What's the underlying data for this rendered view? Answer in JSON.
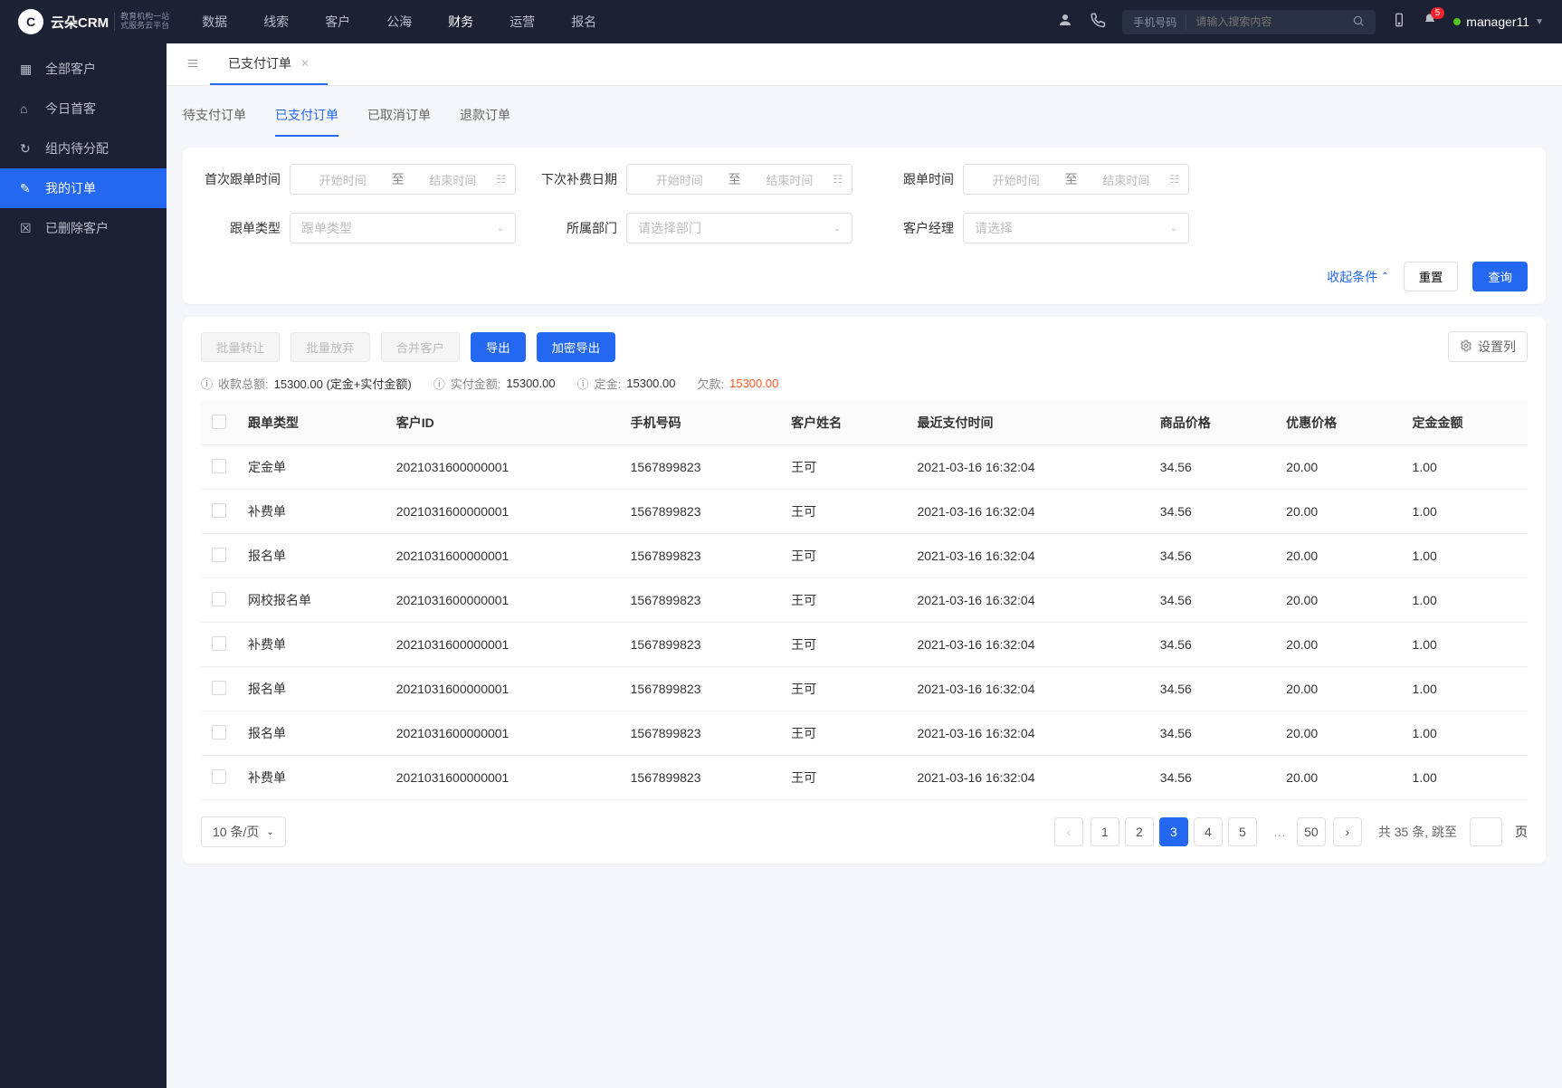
{
  "logo": {
    "brand": "云朵CRM",
    "sub1": "教育机构一站",
    "sub2": "式服务云平台"
  },
  "topnav": {
    "items": [
      "数据",
      "线索",
      "客户",
      "公海",
      "财务",
      "运营",
      "报名"
    ],
    "active": 4
  },
  "search": {
    "type_label": "手机号码",
    "placeholder": "请输入搜索内容"
  },
  "notif_count": "5",
  "user_name": "manager11",
  "sidebar": {
    "items": [
      {
        "label": "全部客户"
      },
      {
        "label": "今日首客"
      },
      {
        "label": "组内待分配"
      },
      {
        "label": "我的订单"
      },
      {
        "label": "已删除客户"
      }
    ],
    "active": 3
  },
  "page_tab": {
    "label": "已支付订单"
  },
  "sub_tabs": {
    "items": [
      "待支付订单",
      "已支付订单",
      "已取消订单",
      "退款订单"
    ],
    "active": 1
  },
  "filters": {
    "first_follow": {
      "label": "首次跟单时间",
      "start": "开始时间",
      "end": "结束时间",
      "split": "至"
    },
    "next_fee": {
      "label": "下次补费日期",
      "start": "开始时间",
      "end": "结束时间",
      "split": "至"
    },
    "follow_time": {
      "label": "跟单时间",
      "start": "开始时间",
      "end": "结束时间",
      "split": "至"
    },
    "follow_type": {
      "label": "跟单类型",
      "placeholder": "跟单类型"
    },
    "dept": {
      "label": "所属部门",
      "placeholder": "请选择部门"
    },
    "manager": {
      "label": "客户经理",
      "placeholder": "请选择"
    },
    "collapse": "收起条件",
    "reset": "重置",
    "query": "查询"
  },
  "toolbar": {
    "batch_transfer": "批量转让",
    "batch_abandon": "批量放弃",
    "merge": "合并客户",
    "export": "导出",
    "encrypt_export": "加密导出",
    "settings": "设置列"
  },
  "stats": {
    "receive_label": "收款总额:",
    "receive_val": "15300.00 (定金+实付金额)",
    "paid_label": "实付金额:",
    "paid_val": "15300.00",
    "deposit_label": "定金:",
    "deposit_val": "15300.00",
    "debt_label": "欠款:",
    "debt_val": "15300.00"
  },
  "columns": [
    "跟单类型",
    "客户ID",
    "手机号码",
    "客户姓名",
    "最近支付时间",
    "商品价格",
    "优惠价格",
    "定金金额"
  ],
  "rows": [
    [
      "定金单",
      "2021031600000001",
      "1567899823",
      "王可",
      "2021-03-16 16:32:04",
      "34.56",
      "20.00",
      "1.00"
    ],
    [
      "补费单",
      "2021031600000001",
      "1567899823",
      "王可",
      "2021-03-16 16:32:04",
      "34.56",
      "20.00",
      "1.00"
    ],
    [
      "报名单",
      "2021031600000001",
      "1567899823",
      "王可",
      "2021-03-16 16:32:04",
      "34.56",
      "20.00",
      "1.00"
    ],
    [
      "网校报名单",
      "2021031600000001",
      "1567899823",
      "王可",
      "2021-03-16 16:32:04",
      "34.56",
      "20.00",
      "1.00"
    ],
    [
      "补费单",
      "2021031600000001",
      "1567899823",
      "王可",
      "2021-03-16 16:32:04",
      "34.56",
      "20.00",
      "1.00"
    ],
    [
      "报名单",
      "2021031600000001",
      "1567899823",
      "王可",
      "2021-03-16 16:32:04",
      "34.56",
      "20.00",
      "1.00"
    ],
    [
      "报名单",
      "2021031600000001",
      "1567899823",
      "王可",
      "2021-03-16 16:32:04",
      "34.56",
      "20.00",
      "1.00"
    ],
    [
      "补费单",
      "2021031600000001",
      "1567899823",
      "王可",
      "2021-03-16 16:32:04",
      "34.56",
      "20.00",
      "1.00"
    ]
  ],
  "pagination": {
    "per_page_label": "10 条/页",
    "pages": [
      "1",
      "2",
      "3",
      "4",
      "5"
    ],
    "active": 2,
    "last": "50",
    "total_prefix": "共",
    "total_n": "35",
    "total_suffix": "条,",
    "jump_prefix": "跳至",
    "jump_suffix": "页"
  }
}
